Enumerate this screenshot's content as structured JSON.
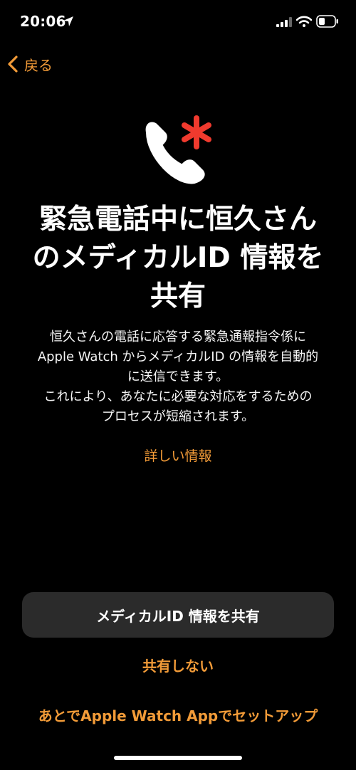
{
  "status_bar": {
    "time": "20:06",
    "icons": [
      "location-arrow-icon",
      "cellular-signal-icon",
      "wifi-icon",
      "battery-icon"
    ]
  },
  "nav": {
    "back_label": "戻る",
    "back_icon": "chevron-left-icon"
  },
  "hero": {
    "icon": "phone-with-asterisk-icon",
    "phone_color": "#ffffff",
    "asterisk_color": "#f03a2e"
  },
  "headline": {
    "title_lines": [
      "緊急電話中に恒久さん",
      "のメディカルID 情報を",
      "共有"
    ]
  },
  "body": {
    "lines": [
      "恒久さんの電話に応答する緊急通報指令係に",
      "Apple Watch からメディカルID の情報を自動的",
      "に送信できます。",
      "これにより、あなたに必要な対応をするための",
      "プロセスが短縮されます。"
    ]
  },
  "links": {
    "more_info": "詳しい情報"
  },
  "actions": {
    "share_label": "メディカルID 情報を共有",
    "dont_share_label": "共有しない",
    "setup_later_label": "あとでApple Watch Appでセットアップ"
  },
  "colors": {
    "accent": "#f29b38",
    "background": "#000000",
    "button_bg": "#2b2b2b"
  }
}
